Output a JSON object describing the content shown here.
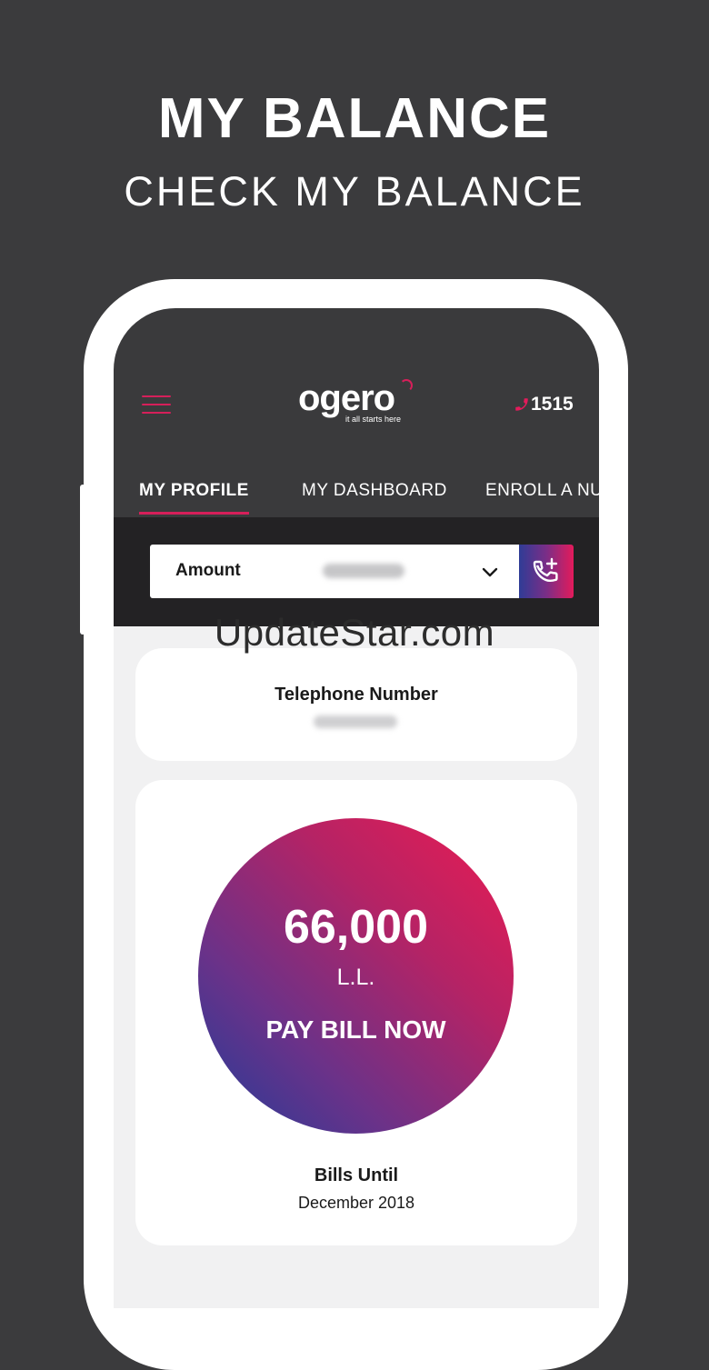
{
  "promo": {
    "title": "MY BALANCE",
    "subtitle": "CHECK MY BALANCE"
  },
  "header": {
    "logo_text": "ogero",
    "logo_tagline": "it all starts here",
    "hotline": "1515"
  },
  "tabs": [
    {
      "label": "MY PROFILE",
      "active": true
    },
    {
      "label": "MY DASHBOARD",
      "active": false
    },
    {
      "label": "ENROLL A NU",
      "active": false
    }
  ],
  "selector": {
    "label": "Amount"
  },
  "telephone": {
    "label": "Telephone Number"
  },
  "balance": {
    "value": "66,000",
    "currency": "L.L.",
    "action": "PAY BILL NOW"
  },
  "bills": {
    "label": "Bills Until",
    "value": "December 2018"
  },
  "watermark": "UpdateStar.com",
  "colors": {
    "background": "#3b3b3d",
    "accent": "#d61f5a",
    "gradient_start": "#ec1b52",
    "gradient_end": "#223c98"
  }
}
